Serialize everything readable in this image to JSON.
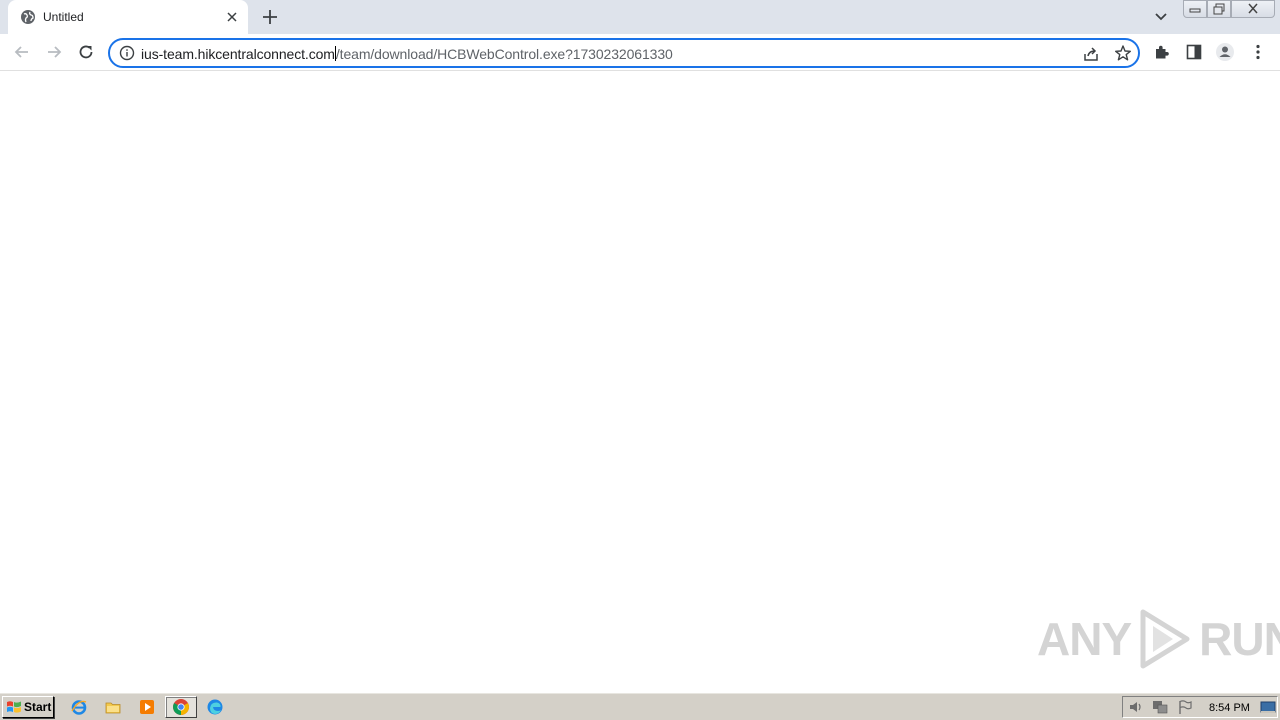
{
  "browser": {
    "tab": {
      "title": "Untitled",
      "favicon": "globe-icon"
    },
    "new_tab_icon": "plus-icon",
    "omnibox": {
      "host": "ius-team.hikcentralconnect.com",
      "path": "/team/download/HCBWebControl.exe?1730232061330",
      "security_icon": "info-icon"
    },
    "colors": {
      "accent": "#1a73e8",
      "tabstrip": "#dee3eb"
    }
  },
  "watermark": {
    "text_left": "ANY",
    "text_right": "RUN"
  },
  "taskbar": {
    "start_label": "Start",
    "clock": "8:54 PM",
    "pinned": [
      "ie-icon",
      "folder-icon",
      "media-player-icon",
      "chrome-icon",
      "edge-icon"
    ]
  }
}
